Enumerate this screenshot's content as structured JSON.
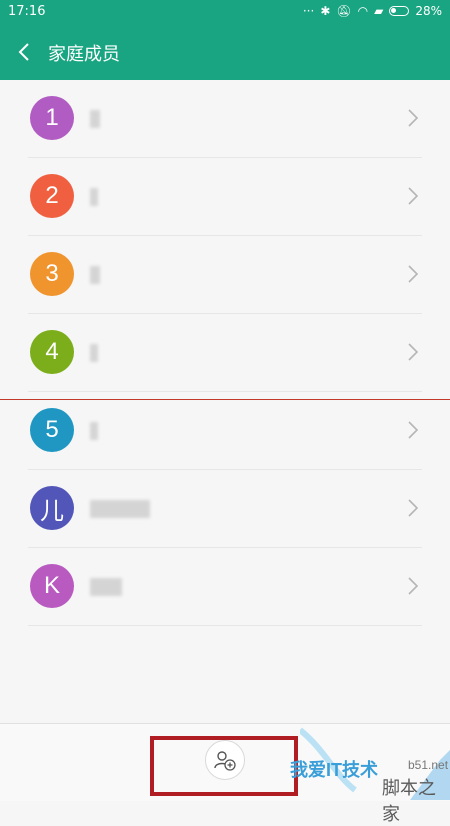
{
  "status_bar": {
    "time": "17:16",
    "battery_percent": "28%"
  },
  "header": {
    "title": "家庭成员"
  },
  "members": [
    {
      "initial": "1",
      "color": "#b05cc2"
    },
    {
      "initial": "2",
      "color": "#f06040"
    },
    {
      "initial": "3",
      "color": "#f0942e"
    },
    {
      "initial": "4",
      "color": "#7bae1a"
    },
    {
      "initial": "5",
      "color": "#1f97c2"
    },
    {
      "initial": "儿",
      "color": "#5156b8"
    },
    {
      "initial": "K",
      "color": "#b85ac0"
    }
  ],
  "bottom": {
    "add_icon": "add-member-icon"
  },
  "watermark": {
    "line1": "我爱IT技术",
    "line2": "脚本之家",
    "line3": "b51.net"
  },
  "accents": {
    "app_bar": "#1aa582",
    "highlight": "#b01e23"
  }
}
